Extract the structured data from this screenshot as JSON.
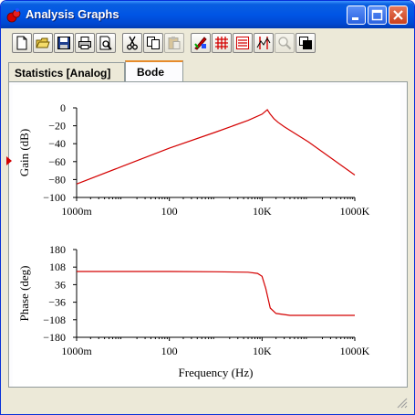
{
  "window": {
    "title": "Analysis Graphs",
    "titlebar_color": "#0055e5"
  },
  "toolbar": {
    "buttons": [
      {
        "icon": "new-document-icon"
      },
      {
        "icon": "open-folder-icon"
      },
      {
        "icon": "save-icon"
      },
      {
        "icon": "print-icon"
      },
      {
        "icon": "print-preview-icon"
      },
      {
        "icon": "cut-icon"
      },
      {
        "icon": "copy-icon"
      },
      {
        "icon": "paste-icon",
        "disabled": true
      },
      {
        "icon": "properties-icon"
      },
      {
        "icon": "grid-icon"
      },
      {
        "icon": "legend-icon"
      },
      {
        "icon": "cursors-icon"
      },
      {
        "icon": "zoom-icon",
        "disabled": true
      },
      {
        "icon": "reverse-colors-icon"
      }
    ]
  },
  "tabs": [
    {
      "label": "Statistics [Analog]",
      "active": false
    },
    {
      "label": "Bode",
      "active": true
    }
  ],
  "chart_data": [
    {
      "type": "line",
      "ylabel": "Gain (dB)",
      "xlabel": "",
      "x_scale": "log",
      "x_ticks": [
        "1000m",
        "100",
        "10K",
        "1000K"
      ],
      "y_ticks": [
        "0",
        "−20",
        "−40",
        "−60",
        "−80",
        "−100"
      ],
      "xlim": [
        1,
        1000000
      ],
      "ylim": [
        -100,
        0
      ],
      "series": [
        {
          "color": "#d40000",
          "x": [
            1,
            10,
            100,
            1000,
            5000,
            10000,
            13000,
            15000,
            18000,
            22000,
            30000,
            100000,
            1000000
          ],
          "y": [
            -85,
            -65,
            -45,
            -27,
            -14,
            -7,
            -2,
            -7,
            -12,
            -16,
            -21,
            -38,
            -75
          ]
        }
      ]
    },
    {
      "type": "line",
      "ylabel": "Phase (deg)",
      "xlabel": "Frequency (Hz)",
      "x_scale": "log",
      "x_ticks": [
        "1000m",
        "100",
        "10K",
        "1000K"
      ],
      "y_ticks": [
        "180",
        "108",
        "36",
        "−36",
        "−108",
        "−180"
      ],
      "xlim": [
        1,
        1000000
      ],
      "ylim": [
        -180,
        180
      ],
      "series": [
        {
          "color": "#d40000",
          "x": [
            1,
            100,
            1000,
            5000,
            8000,
            10000,
            12000,
            15000,
            20000,
            40000,
            1000000
          ],
          "y": [
            90,
            90,
            89,
            87,
            82,
            70,
            20,
            -60,
            -82,
            -90,
            -90
          ]
        }
      ]
    }
  ]
}
